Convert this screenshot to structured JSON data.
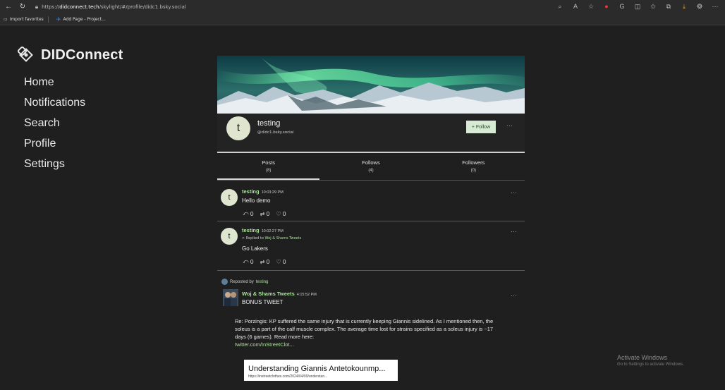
{
  "browser": {
    "url_prefix": "https://",
    "url_host": "didconnect.tech",
    "url_path": "/skylight/#/profile/didc1.bsky.social",
    "bookmarks": [
      "Import favorites",
      "Add Page - Project..."
    ]
  },
  "brand": {
    "name": "DIDConnect"
  },
  "nav": [
    "Home",
    "Notifications",
    "Search",
    "Profile",
    "Settings"
  ],
  "profile": {
    "avatar_letter": "t",
    "name": "testing",
    "handle": "@didc1.bsky.social",
    "follow_label": "+ Follow",
    "more": "···"
  },
  "tabs": [
    {
      "label": "Posts",
      "count": "(8)"
    },
    {
      "label": "Follows",
      "count": "(4)"
    },
    {
      "label": "Followers",
      "count": "(0)"
    }
  ],
  "posts": [
    {
      "avatar": "t",
      "author": "testing",
      "time": "10:03:29 PM",
      "text": "Hello demo",
      "replies": "0",
      "reposts": "0",
      "likes": "0"
    },
    {
      "avatar": "t",
      "author": "testing",
      "time": "10:02:27 PM",
      "reply_prefix": "> Replied to",
      "reply_to": "Woj & Shams Tweets",
      "text": "Go Lakers",
      "replies": "0",
      "reposts": "0",
      "likes": "0"
    },
    {
      "repost_prefix": "Reposted by",
      "repost_by": "testing",
      "author": "Woj & Shams Tweets",
      "time": "4:15:52 PM",
      "text": "BONUS TWEET",
      "body": "Re: Porzingis: KP suffered the same injury that is currently keeping Giannis sidelined. As I mentioned then, the soleus is a part of the calf muscle complex. The average time lost for strains specified as a soleus injury is ~17 days (6 games). Read more here:",
      "link_text": "twitter.com/InStreetClot...",
      "card_title": "Understanding Giannis Antetokounmp...",
      "card_url": "https://instreetclothes.com/2024/04/09/understan..."
    }
  ],
  "watermark": {
    "title": "Activate Windows",
    "subtitle": "Go to Settings to activate Windows."
  }
}
